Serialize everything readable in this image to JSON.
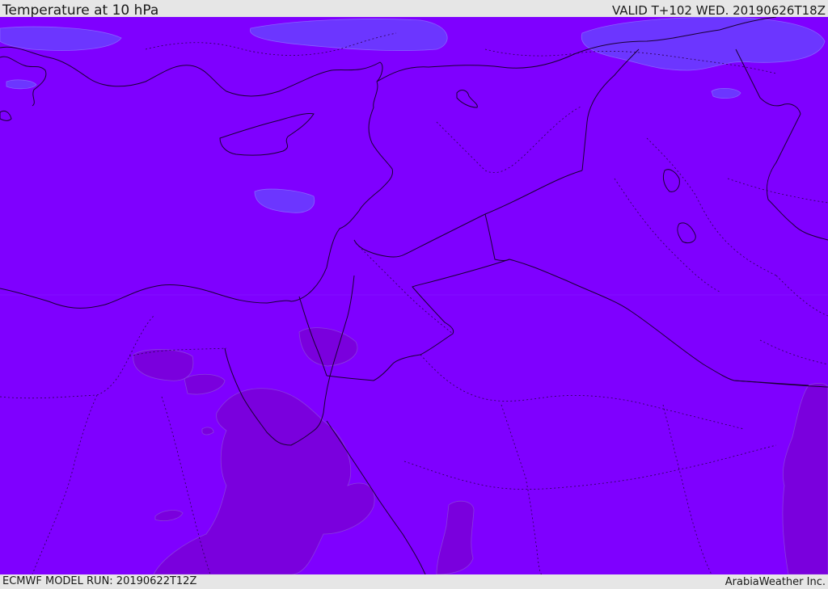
{
  "header": {
    "title": "Temperature at 10 hPa",
    "valid": "VALID T+102 WED. 20190626T18Z"
  },
  "footer": {
    "model_run": "ECMWF MODEL RUN: 20190622T12Z",
    "credit": "ArabiaWeather Inc."
  },
  "map": {
    "colors": {
      "base_fill": "#7f00ff",
      "cooler_fill": "#6a3cff",
      "warmer_fill": "#7a00dd",
      "coastline": "#1a0033",
      "border": "#1a0033"
    }
  }
}
